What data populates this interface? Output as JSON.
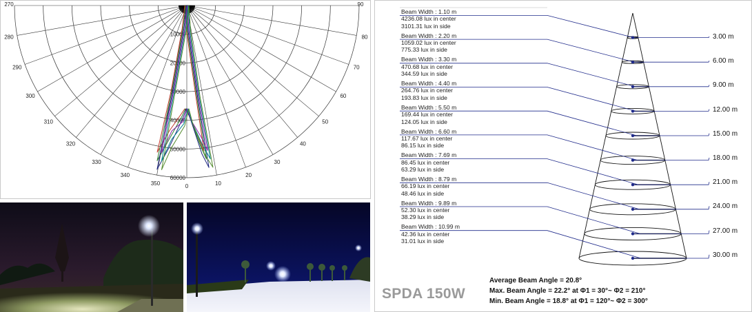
{
  "chart_data": [
    {
      "type": "polar",
      "angle_labels": [
        "270",
        "280",
        "290",
        "300",
        "310",
        "320",
        "330",
        "340",
        "350",
        "0",
        "10",
        "20",
        "30",
        "40",
        "50",
        "60",
        "70",
        "80",
        "90"
      ],
      "radial_labels": [
        "10000",
        "20000",
        "30000",
        "40000",
        "50000",
        "60000"
      ],
      "rlim": [
        0,
        60000
      ],
      "series_colors": [
        "#c0392b",
        "#2e7d32",
        "#1a237e",
        "#8e24aa",
        "#00838f",
        "#558b2f"
      ]
    },
    {
      "type": "table",
      "rows": [
        {
          "beam_width": "Beam Width : 1.10 m",
          "center": "4236.08  lux  in  center",
          "side": "3101.31 lux in side",
          "distance": "3.00 m"
        },
        {
          "beam_width": "Beam Width : 2.20 m",
          "center": "1059.02 lux in center",
          "side": "775.33 lux in side",
          "distance": "6.00 m"
        },
        {
          "beam_width": "Beam Width : 3.30 m",
          "center": "470.68 lux in center",
          "side": "344.59 lux in side",
          "distance": "9.00 m"
        },
        {
          "beam_width": "Beam Width : 4.40 m",
          "center": "264.76 lux in center",
          "side": "193.83 lux in side",
          "distance": "12.00 m"
        },
        {
          "beam_width": "Beam Width : 5.50 m",
          "center": "169.44 lux in center",
          "side": "124.05 lux in side",
          "distance": "15.00 m"
        },
        {
          "beam_width": "Beam Width : 6.60 m",
          "center": "117.67 lux in center",
          "side": "86.15 lux in side",
          "distance": "18.00 m"
        },
        {
          "beam_width": "Beam Width : 7.69 m",
          "center": "86.45 lux in center",
          "side": "63.29 lux in side",
          "distance": "21.00 m"
        },
        {
          "beam_width": "Beam Width : 8.79 m",
          "center": "66.19 lux in center",
          "side": "48.46 lux in side",
          "distance": "24.00 m"
        },
        {
          "beam_width": "Beam Width : 9.89 m",
          "center": "52.30 lux in center",
          "side": "38.29 lux in side",
          "distance": "27.00 m"
        },
        {
          "beam_width": "Beam Width : 10.99 m",
          "center": "42.36 lux in center",
          "side": "31.01 lux in side",
          "distance": "30.00 m"
        }
      ]
    }
  ],
  "product": "SPDA 150W",
  "summary": {
    "average": "Average Beam Angle =  20.8°",
    "max": "Max. Beam Angle = 22.2° at Φ1 = 30°~ Φ2 = 210°",
    "min": "Min. Beam Angle = 18.8° at Φ1 = 120°~ Φ2 = 300°"
  },
  "colors": {
    "leader_line": "#1f2a8a",
    "cone": "#111111",
    "border": "#c8c8c8",
    "product": "#9a9a9a"
  }
}
